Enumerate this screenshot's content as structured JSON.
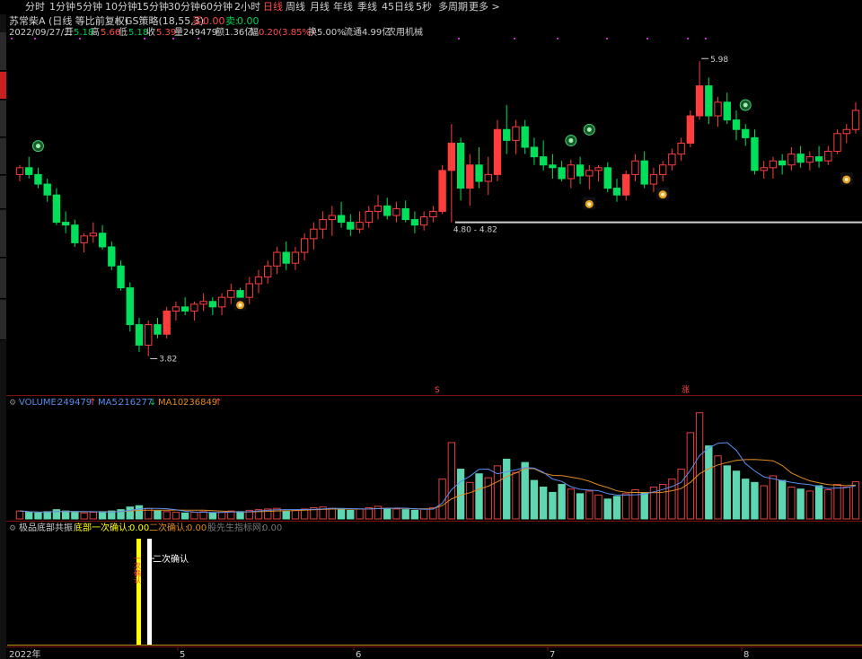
{
  "periods": [
    {
      "label": "分时",
      "active": false
    },
    {
      "label": "1分钟",
      "active": false
    },
    {
      "label": "5分钟",
      "active": false
    },
    {
      "label": "10分钟",
      "active": false
    },
    {
      "label": "15分钟",
      "active": false
    },
    {
      "label": "30分钟",
      "active": false
    },
    {
      "label": "60分钟",
      "active": false
    },
    {
      "label": "2小时",
      "active": false
    },
    {
      "label": "日线",
      "active": true
    },
    {
      "label": "周线",
      "active": false
    },
    {
      "label": "月线",
      "active": false
    },
    {
      "label": "年线",
      "active": false
    },
    {
      "label": "季线",
      "active": false
    },
    {
      "label": "45日线",
      "active": false
    },
    {
      "label": "5秒",
      "active": false
    },
    {
      "label": "多周期",
      "active": false
    },
    {
      "label": "更多 >",
      "active": false
    }
  ],
  "header": {
    "stock": "苏常柴A (日线 等比前复权)",
    "strategy": "GS策略(18,55,3)",
    "buy_label": "买:",
    "buy_value": "0.00",
    "sell_label": "卖:",
    "sell_value": "0.00"
  },
  "quote": {
    "date": "2022/09/27/二",
    "open_label": "开",
    "open": "5.18",
    "high_label": "高",
    "high": "5.66",
    "low_label": "低",
    "low": "5.18",
    "close_label": "收",
    "close": "5.39",
    "vol_label": "量",
    "vol": "249479",
    "amount_label": "额",
    "amount": "1.36亿",
    "change_label": "幅",
    "change": "0.20(3.85%)",
    "turnover_label": "换",
    "turnover": "5.00%",
    "float_label": "流通",
    "float": "4.99亿",
    "industry": "农用机械"
  },
  "annotations": {
    "high_label": "5.98",
    "low_label": "3.82",
    "range_label": "4.80 - 4.82",
    "marker_s": "S",
    "marker_zhang": "涨"
  },
  "volume_panel": {
    "label": "VOLUME:",
    "value": "249479",
    "value_arrow": "↑",
    "ma5_label": "MA5:",
    "ma5": "216277",
    "ma5_arrow": "↓",
    "ma10_label": "MA10:",
    "ma10": "236849",
    "ma10_arrow": "↑"
  },
  "indicator_panel": {
    "name": "极品底部共振",
    "first_label": "底部一次确认:",
    "first": "0.00",
    "second_label": "二次确认:",
    "second": "0.00",
    "credit": "股先生指标网:",
    "credit_value": "0.00",
    "first_bar_text": "一次确认",
    "second_bar_text": "二次确认"
  },
  "date_axis": {
    "year": "2022年",
    "months": [
      "5",
      "6",
      "7",
      "8"
    ]
  },
  "colors": {
    "up": "#ff3d3d",
    "down": "#00e05a",
    "ma5": "#5b8def",
    "ma10": "#e08a20",
    "vol_down": "#5ed6b2",
    "yellow": "#ffff00"
  },
  "chart_data": {
    "type": "candlestick",
    "ylim": [
      3.6,
      6.1
    ],
    "high_marker": 5.98,
    "low_marker": 3.82,
    "support": [
      4.8,
      4.82
    ],
    "candles": [
      [
        5.15,
        5.22,
        5.1,
        5.2
      ],
      [
        5.2,
        5.28,
        5.12,
        5.15
      ],
      [
        5.15,
        5.2,
        5.05,
        5.08
      ],
      [
        5.08,
        5.12,
        4.95,
        5.0
      ],
      [
        5.0,
        5.05,
        4.78,
        4.8
      ],
      [
        4.8,
        4.88,
        4.72,
        4.78
      ],
      [
        4.78,
        4.82,
        4.62,
        4.65
      ],
      [
        4.65,
        4.72,
        4.58,
        4.7
      ],
      [
        4.7,
        4.8,
        4.65,
        4.72
      ],
      [
        4.72,
        4.78,
        4.6,
        4.62
      ],
      [
        4.62,
        4.66,
        4.45,
        4.48
      ],
      [
        4.48,
        4.52,
        4.3,
        4.32
      ],
      [
        4.32,
        4.36,
        4.0,
        4.05
      ],
      [
        4.05,
        4.1,
        3.85,
        3.9
      ],
      [
        3.9,
        4.08,
        3.82,
        4.05
      ],
      [
        4.05,
        4.1,
        3.95,
        3.98
      ],
      [
        3.98,
        4.18,
        3.95,
        4.15
      ],
      [
        4.15,
        4.22,
        4.08,
        4.18
      ],
      [
        4.18,
        4.25,
        4.12,
        4.15
      ],
      [
        4.15,
        4.22,
        4.08,
        4.2
      ],
      [
        4.2,
        4.28,
        4.15,
        4.22
      ],
      [
        4.22,
        4.25,
        4.12,
        4.18
      ],
      [
        4.18,
        4.28,
        4.12,
        4.25
      ],
      [
        4.25,
        4.35,
        4.2,
        4.3
      ],
      [
        4.3,
        4.32,
        4.2,
        4.25
      ],
      [
        4.25,
        4.4,
        4.2,
        4.35
      ],
      [
        4.35,
        4.45,
        4.28,
        4.4
      ],
      [
        4.4,
        4.52,
        4.35,
        4.48
      ],
      [
        4.48,
        4.62,
        4.42,
        4.58
      ],
      [
        4.58,
        4.66,
        4.45,
        4.5
      ],
      [
        4.5,
        4.62,
        4.45,
        4.58
      ],
      [
        4.58,
        4.72,
        4.52,
        4.68
      ],
      [
        4.68,
        4.8,
        4.6,
        4.75
      ],
      [
        4.75,
        4.88,
        4.68,
        4.82
      ],
      [
        4.82,
        4.92,
        4.7,
        4.85
      ],
      [
        4.85,
        4.95,
        4.76,
        4.8
      ],
      [
        4.8,
        4.86,
        4.7,
        4.75
      ],
      [
        4.75,
        4.88,
        4.72,
        4.8
      ],
      [
        4.8,
        4.92,
        4.76,
        4.88
      ],
      [
        4.88,
        5.0,
        4.82,
        4.92
      ],
      [
        4.92,
        4.98,
        4.82,
        4.85
      ],
      [
        4.85,
        4.95,
        4.8,
        4.9
      ],
      [
        4.9,
        4.96,
        4.8,
        4.82
      ],
      [
        4.82,
        4.88,
        4.72,
        4.78
      ],
      [
        4.78,
        4.88,
        4.74,
        4.84
      ],
      [
        4.84,
        4.92,
        4.8,
        4.88
      ],
      [
        4.88,
        5.22,
        4.86,
        5.18
      ],
      [
        5.18,
        5.52,
        4.8,
        5.38
      ],
      [
        5.38,
        5.42,
        4.96,
        5.05
      ],
      [
        5.05,
        5.3,
        4.92,
        5.22
      ],
      [
        5.22,
        5.35,
        5.05,
        5.1
      ],
      [
        5.1,
        5.28,
        5.0,
        5.15
      ],
      [
        5.15,
        5.55,
        5.1,
        5.48
      ],
      [
        5.48,
        5.66,
        5.3,
        5.4
      ],
      [
        5.4,
        5.55,
        5.3,
        5.5
      ],
      [
        5.5,
        5.55,
        5.3,
        5.35
      ],
      [
        5.35,
        5.42,
        5.22,
        5.28
      ],
      [
        5.28,
        5.4,
        5.18,
        5.22
      ],
      [
        5.22,
        5.3,
        5.12,
        5.2
      ],
      [
        5.2,
        5.25,
        5.1,
        5.12
      ],
      [
        5.12,
        5.26,
        5.05,
        5.22
      ],
      [
        5.22,
        5.28,
        5.08,
        5.14
      ],
      [
        5.14,
        5.22,
        5.04,
        5.18
      ],
      [
        5.18,
        5.22,
        5.1,
        5.2
      ],
      [
        5.2,
        5.24,
        5.02,
        5.05
      ],
      [
        5.05,
        5.12,
        4.95,
        5.0
      ],
      [
        5.0,
        5.18,
        4.96,
        5.15
      ],
      [
        5.15,
        5.3,
        5.1,
        5.25
      ],
      [
        5.25,
        5.32,
        5.05,
        5.08
      ],
      [
        5.08,
        5.2,
        5.02,
        5.15
      ],
      [
        5.15,
        5.25,
        5.1,
        5.22
      ],
      [
        5.22,
        5.34,
        5.18,
        5.3
      ],
      [
        5.3,
        5.42,
        5.25,
        5.38
      ],
      [
        5.38,
        5.62,
        5.35,
        5.58
      ],
      [
        5.58,
        5.98,
        5.55,
        5.8
      ],
      [
        5.8,
        5.86,
        5.52,
        5.58
      ],
      [
        5.58,
        5.72,
        5.5,
        5.68
      ],
      [
        5.68,
        5.75,
        5.52,
        5.55
      ],
      [
        5.55,
        5.62,
        5.4,
        5.48
      ],
      [
        5.48,
        5.52,
        5.36,
        5.42
      ],
      [
        5.42,
        5.48,
        5.15,
        5.18
      ],
      [
        5.18,
        5.25,
        5.12,
        5.2
      ],
      [
        5.2,
        5.28,
        5.12,
        5.25
      ],
      [
        5.25,
        5.3,
        5.15,
        5.22
      ],
      [
        5.22,
        5.35,
        5.18,
        5.3
      ],
      [
        5.3,
        5.36,
        5.2,
        5.24
      ],
      [
        5.24,
        5.32,
        5.18,
        5.28
      ],
      [
        5.28,
        5.36,
        5.2,
        5.25
      ],
      [
        5.25,
        5.36,
        5.22,
        5.32
      ],
      [
        5.32,
        5.48,
        5.3,
        5.45
      ],
      [
        5.45,
        5.52,
        5.38,
        5.48
      ],
      [
        5.48,
        5.68,
        5.45,
        5.62
      ]
    ],
    "volume": [
      12,
      10,
      9,
      11,
      14,
      12,
      10,
      9,
      10,
      11,
      12,
      14,
      18,
      20,
      16,
      12,
      11,
      10,
      9,
      10,
      11,
      9,
      10,
      12,
      11,
      13,
      14,
      15,
      16,
      12,
      13,
      15,
      17,
      18,
      16,
      14,
      13,
      15,
      17,
      19,
      16,
      15,
      14,
      13,
      15,
      17,
      60,
      115,
      75,
      55,
      68,
      62,
      80,
      90,
      70,
      85,
      58,
      48,
      40,
      52,
      45,
      38,
      42,
      36,
      30,
      34,
      38,
      44,
      40,
      48,
      52,
      60,
      75,
      130,
      160,
      110,
      95,
      80,
      72,
      60,
      55,
      50,
      65,
      58,
      48,
      45,
      42,
      50,
      44,
      52,
      48,
      56
    ],
    "dn_vol_scale": 220000,
    "first_confirm_x": "2022-04-27",
    "second_confirm_x": "2022-04-28"
  }
}
